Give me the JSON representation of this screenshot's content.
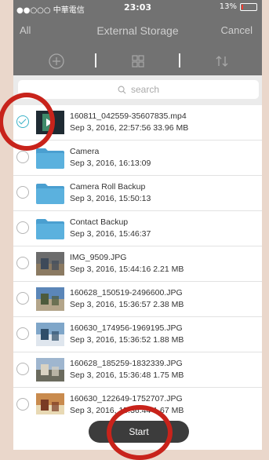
{
  "status_bar": {
    "carrier": "●●○○○ 中華電信",
    "time": "23:03",
    "battery": "13%",
    "battery_level": 0.13
  },
  "nav": {
    "all_label": "All",
    "title": "External Storage",
    "cancel_label": "Cancel"
  },
  "toolbar": {
    "icons": [
      "add-icon",
      "grid-icon",
      "sort-icon"
    ]
  },
  "search": {
    "placeholder": "search"
  },
  "files": [
    {
      "name": "160811_042559-35607835.mp4",
      "meta": "Sep 3, 2016, 22:57:56  33.96 MB",
      "type": "video",
      "selected": true
    },
    {
      "name": "Camera",
      "meta": "Sep 3, 2016, 16:13:09",
      "type": "folder",
      "selected": false
    },
    {
      "name": "Camera Roll Backup",
      "meta": "Sep 3, 2016, 15:50:13",
      "type": "folder",
      "selected": false
    },
    {
      "name": "Contact Backup",
      "meta": "Sep 3, 2016, 15:46:37",
      "type": "folder",
      "selected": false
    },
    {
      "name": "IMG_9509.JPG",
      "meta": "Sep 3, 2016, 15:44:16  2.21 MB",
      "type": "image",
      "selected": false
    },
    {
      "name": "160628_150519-2496600.JPG",
      "meta": "Sep 3, 2016, 15:36:57  2.38 MB",
      "type": "image",
      "selected": false
    },
    {
      "name": "160630_174956-1969195.JPG",
      "meta": "Sep 3, 2016, 15:36:52  1.88 MB",
      "type": "image",
      "selected": false
    },
    {
      "name": "160628_185259-1832339.JPG",
      "meta": "Sep 3, 2016, 15:36:48  1.75 MB",
      "type": "image",
      "selected": false
    },
    {
      "name": "160630_122649-1752707.JPG",
      "meta": "Sep 3, 2016, 15:36:44  1.67 MB",
      "type": "image",
      "selected": false
    }
  ],
  "start_label": "Start",
  "colors": {
    "bar": "#727272",
    "accent": "#3db3c8",
    "folder": "#4a9fd0",
    "annotation": "#c8231b"
  }
}
